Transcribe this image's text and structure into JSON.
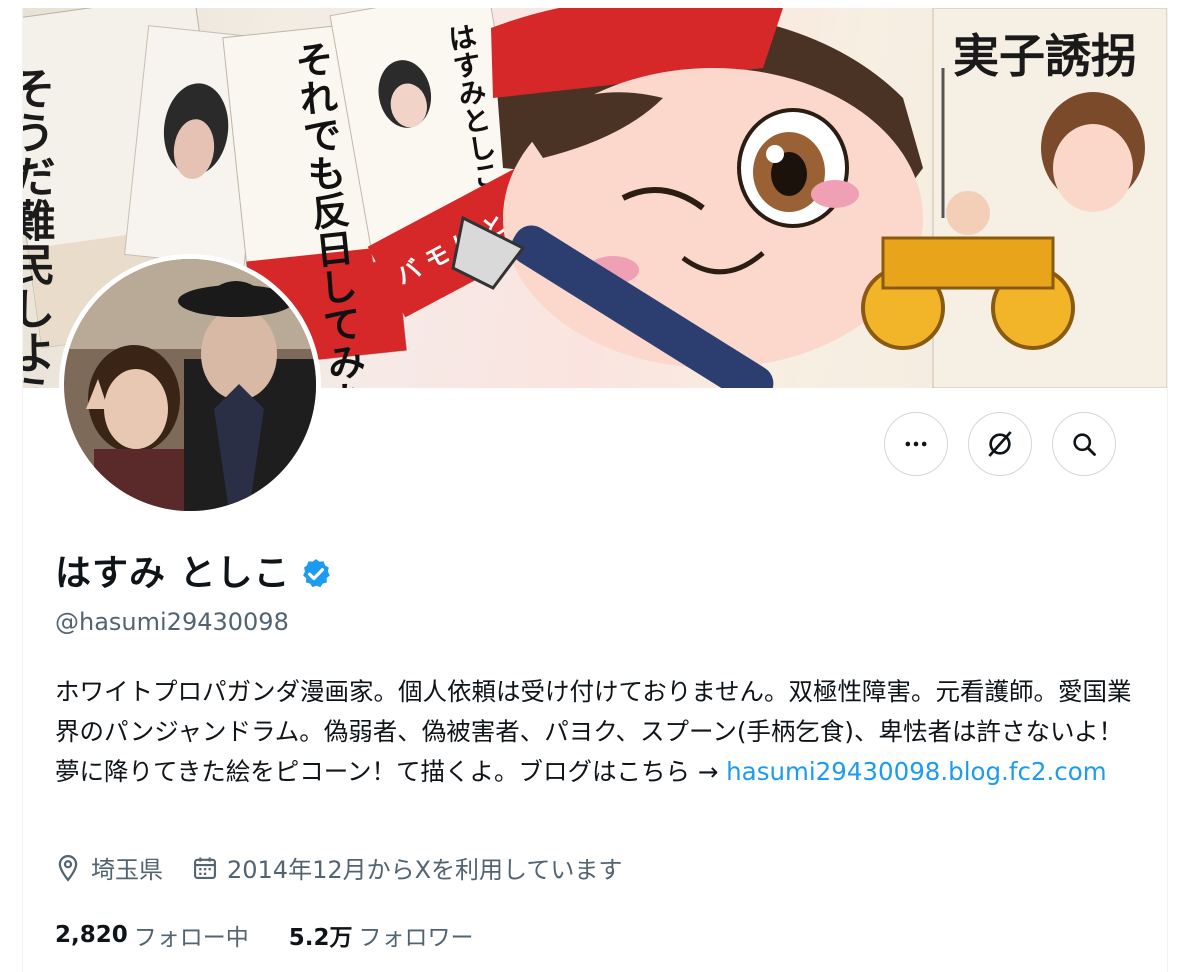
{
  "banner": {
    "cover_texts": [
      "そうだ難民しよう",
      "はすみとしこの世界",
      "それでも反日してみたい",
      "はすみとしこ",
      "バ モ け とし こが 描く！",
      "実子誘拐"
    ],
    "colors": {
      "red": "#d62828",
      "hair": "#4a3324",
      "skin": "#fbd7cc",
      "pen": "#2c3e70"
    }
  },
  "profile": {
    "name": "はすみ としこ",
    "handle": "@hasumi29430098",
    "verified": true,
    "bio_text": "ホワイトプロパガンダ漫画家。個人依頼は受け付けておりません。双極性障害。元看護師。愛国業界のパンジャンドラム。偽弱者、偽被害者、パヨク、スプーン(手柄乞食)、卑怯者は許さないよ！夢に降りてきた絵をピコーン！て描くよ。ブログはこちら →",
    "bio_link": "hasumi29430098.blog.fc2.com",
    "location": "埼玉県",
    "joined": "2014年12月からXを利用しています"
  },
  "stats": {
    "following_count": "2,820",
    "following_label": "フォロー中",
    "followers_count": "5.2万",
    "followers_label": "フォロワー"
  },
  "actions": {
    "more_icon": "more-icon",
    "grok_icon": "grok-icon",
    "search_icon": "search-icon"
  },
  "colors": {
    "accent": "#1d9bf0",
    "text": "#0f1419",
    "muted": "#536471",
    "border": "#cfd9de"
  }
}
